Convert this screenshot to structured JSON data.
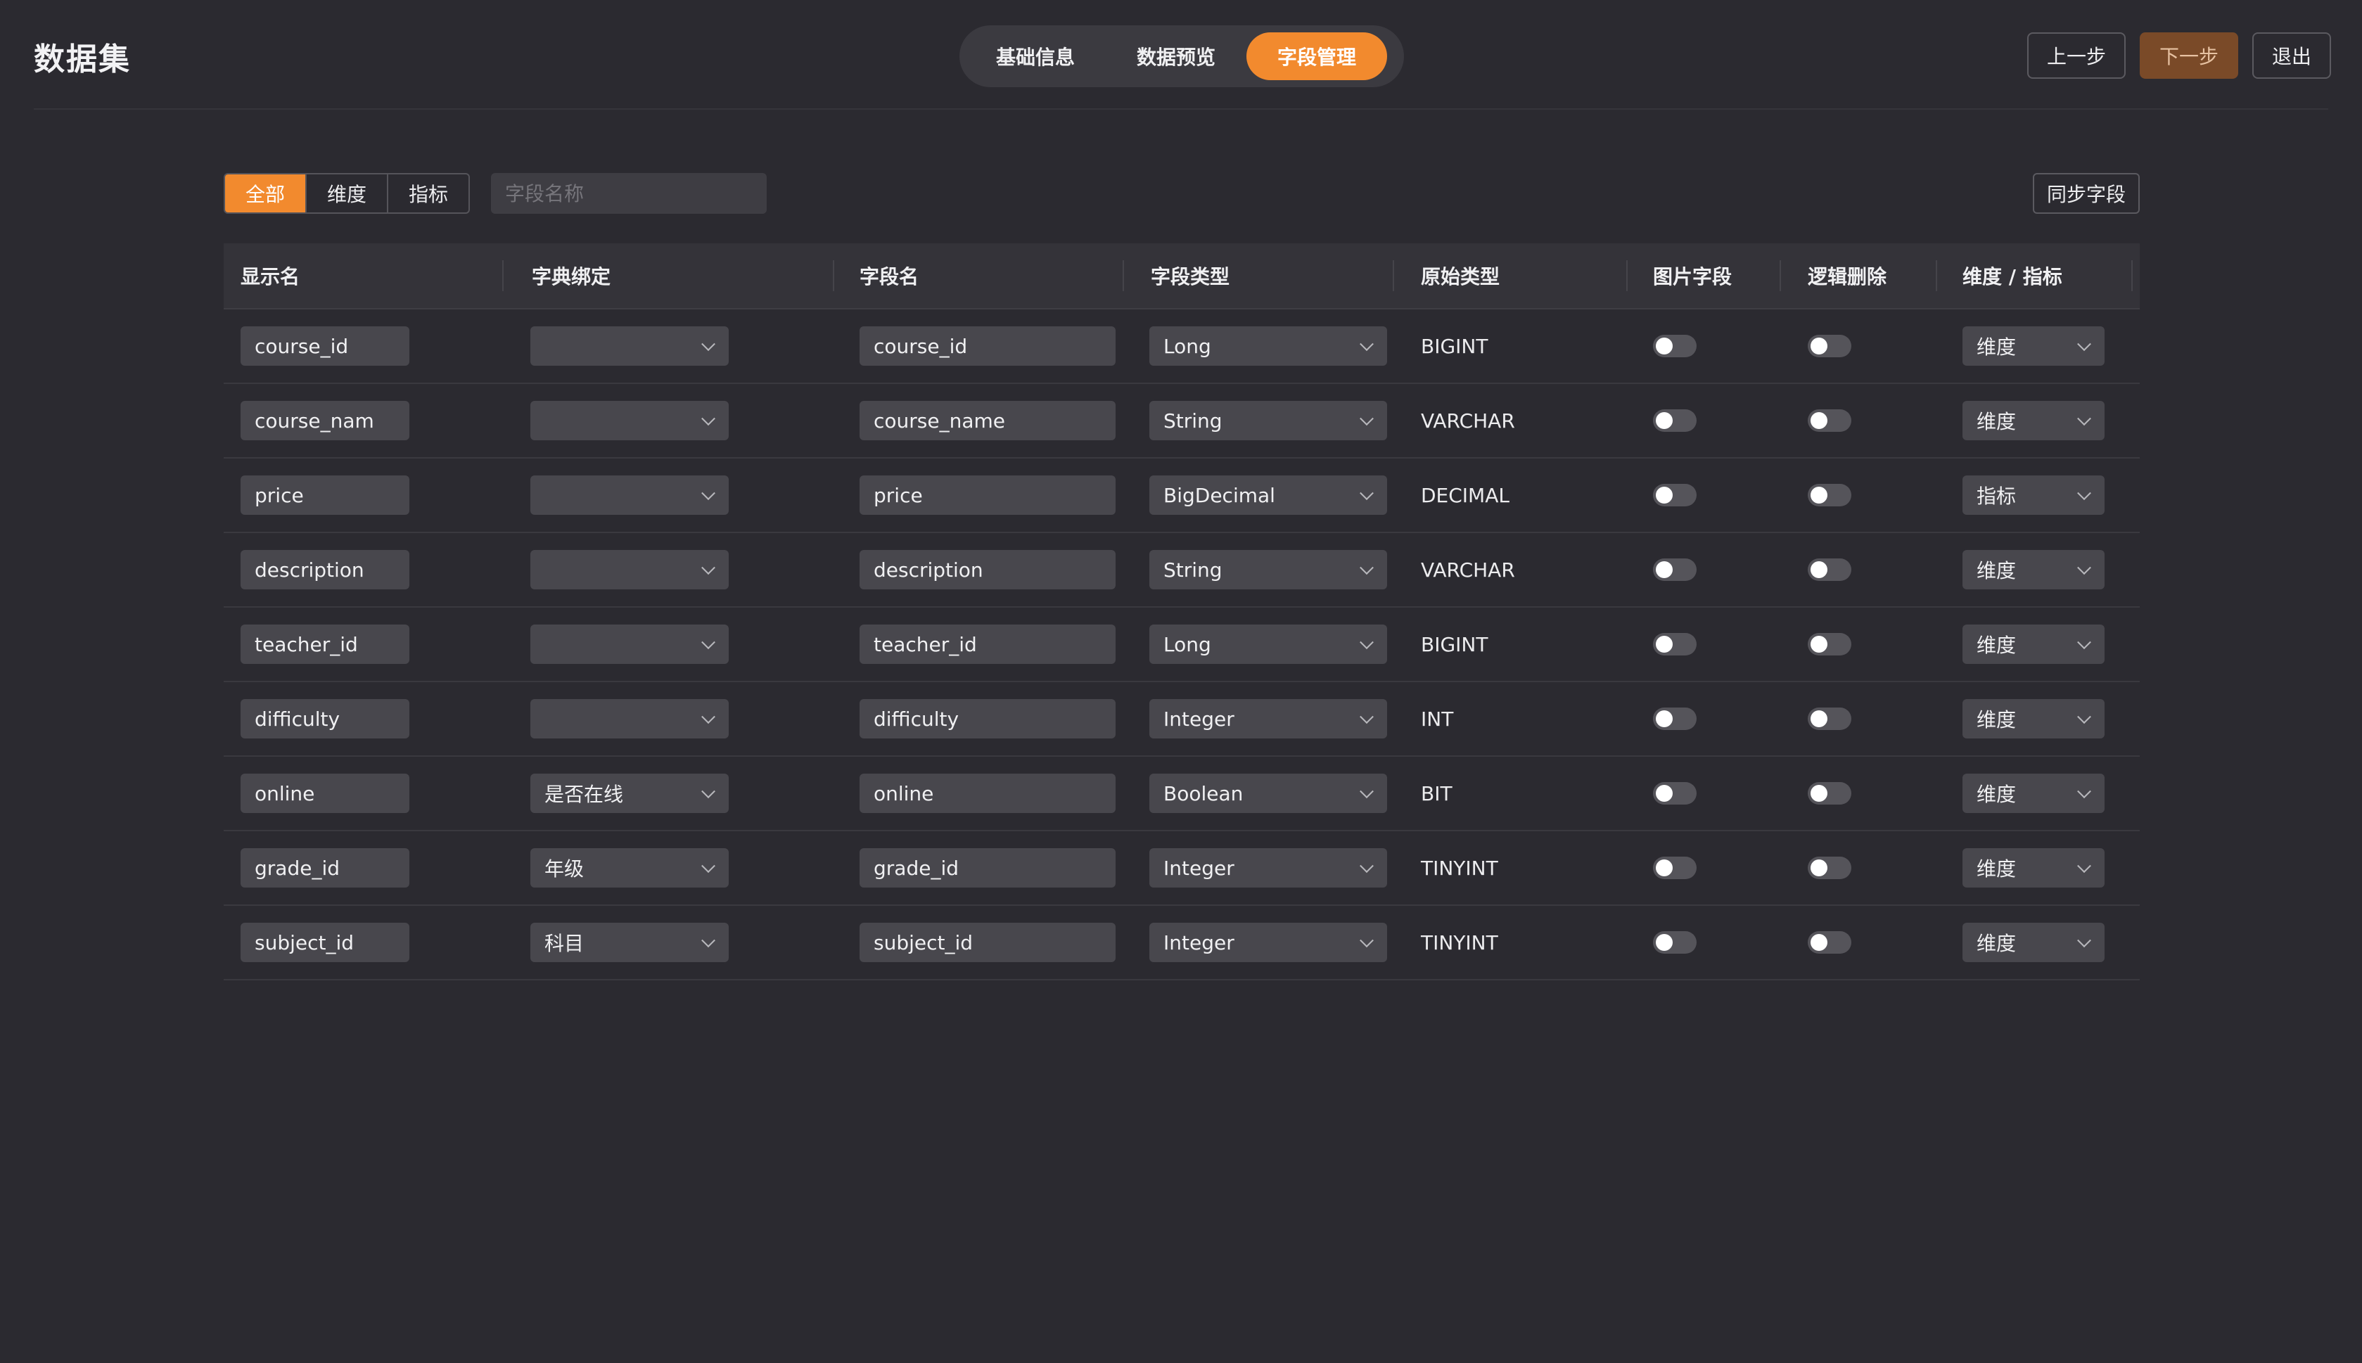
{
  "app": {
    "title": "数据集"
  },
  "tabs": [
    {
      "label": "基础信息",
      "active": false
    },
    {
      "label": "数据预览",
      "active": false
    },
    {
      "label": "字段管理",
      "active": true
    }
  ],
  "nav": {
    "prev": "上一步",
    "next": "下一步",
    "exit": "退出"
  },
  "filter": {
    "segments": [
      {
        "label": "全部",
        "active": true
      },
      {
        "label": "维度",
        "active": false
      },
      {
        "label": "指标",
        "active": false
      }
    ],
    "search_placeholder": "字段名称",
    "sync_label": "同步字段"
  },
  "table": {
    "headers": [
      "显示名",
      "字典绑定",
      "字段名",
      "字段类型",
      "原始类型",
      "图片字段",
      "逻辑删除",
      "维度 / 指标"
    ],
    "rows": [
      {
        "display": "course_id",
        "dict": "",
        "field": "course_id",
        "type": "Long",
        "raw": "BIGINT",
        "image": false,
        "logic_delete": false,
        "role": "维度"
      },
      {
        "display": "course_nam",
        "dict": "",
        "field": "course_name",
        "type": "String",
        "raw": "VARCHAR",
        "image": false,
        "logic_delete": false,
        "role": "维度"
      },
      {
        "display": "price",
        "dict": "",
        "field": "price",
        "type": "BigDecimal",
        "raw": "DECIMAL",
        "image": false,
        "logic_delete": false,
        "role": "指标"
      },
      {
        "display": "description",
        "dict": "",
        "field": "description",
        "type": "String",
        "raw": "VARCHAR",
        "image": false,
        "logic_delete": false,
        "role": "维度"
      },
      {
        "display": "teacher_id",
        "dict": "",
        "field": "teacher_id",
        "type": "Long",
        "raw": "BIGINT",
        "image": false,
        "logic_delete": false,
        "role": "维度"
      },
      {
        "display": "difficulty",
        "dict": "",
        "field": "difficulty",
        "type": "Integer",
        "raw": "INT",
        "image": false,
        "logic_delete": false,
        "role": "维度"
      },
      {
        "display": "online",
        "dict": "是否在线",
        "field": "online",
        "type": "Boolean",
        "raw": "BIT",
        "image": false,
        "logic_delete": false,
        "role": "维度"
      },
      {
        "display": "grade_id",
        "dict": "年级",
        "field": "grade_id",
        "type": "Integer",
        "raw": "TINYINT",
        "image": false,
        "logic_delete": false,
        "role": "维度"
      },
      {
        "display": "subject_id",
        "dict": "科目",
        "field": "subject_id",
        "type": "Integer",
        "raw": "TINYINT",
        "image": false,
        "logic_delete": false,
        "role": "维度"
      }
    ]
  },
  "colors": {
    "background": "#2b2a30",
    "accent": "#f28a2e"
  }
}
